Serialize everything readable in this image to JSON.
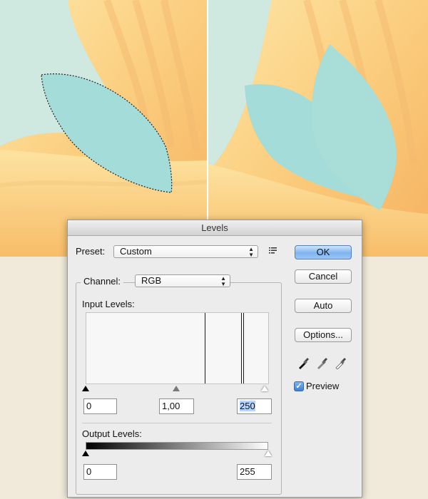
{
  "dialog": {
    "title": "Levels",
    "preset": {
      "label": "Preset:",
      "value": "Custom",
      "menu_icon": "preset-options-icon"
    },
    "channel": {
      "label": "Channel:",
      "value": "RGB"
    },
    "input_levels": {
      "label": "Input Levels:",
      "black": "0",
      "midtone": "1,00",
      "white": "250"
    },
    "output_levels": {
      "label": "Output Levels:",
      "black": "0",
      "white": "255"
    },
    "buttons": {
      "ok": "OK",
      "cancel": "Cancel",
      "auto": "Auto",
      "options": "Options..."
    },
    "eyedroppers": [
      "black-eyedropper-icon",
      "gray-eyedropper-icon",
      "white-eyedropper-icon"
    ],
    "preview": {
      "label": "Preview",
      "checked": true
    }
  },
  "colors": {
    "background": "#f1eadb",
    "sky": "#cde8e0",
    "petal": "#fcd58a",
    "leaf": "#a3dcd8",
    "accent": "#7db4ef"
  }
}
